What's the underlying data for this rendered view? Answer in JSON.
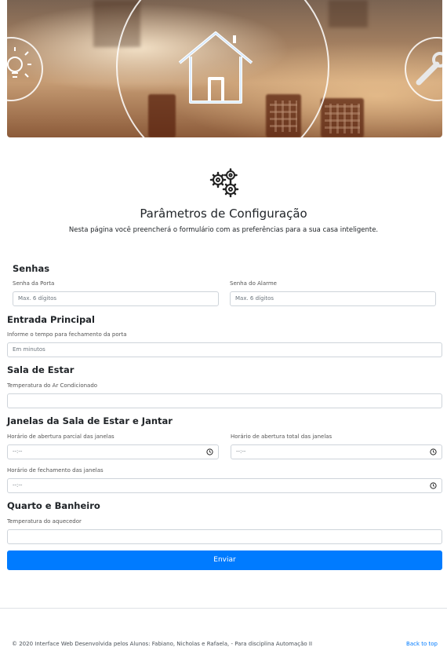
{
  "header": {
    "title": "Parâmetros de Configuração",
    "subtitle": "Nesta página você preencherá o formulário com as preferências para a sua casa inteligente."
  },
  "sections": {
    "senhas": {
      "title": "Senhas",
      "porta_label": "Senha da Porta",
      "porta_placeholder": "Max. 6 dígitos",
      "alarme_label": "Senha do Alarme",
      "alarme_placeholder": "Max. 6 dígitos"
    },
    "entrada": {
      "title": "Entrada Principal",
      "tempo_label": "Informe o tempo para fechamento da porta",
      "tempo_placeholder": "Em minutos"
    },
    "sala": {
      "title": "Sala de Estar",
      "temp_label": "Temperatura do Ar Condicionado",
      "temp_value": ""
    },
    "janelas": {
      "title": "Janelas da Sala de Estar e Jantar",
      "parcial_label": "Horário de abertura parcial das janelas",
      "parcial_value": "--:--",
      "total_label": "Horário de abertura total das janelas",
      "total_value": "--:--",
      "fechamento_label": "Horário de fechamento das janelas",
      "fechamento_value": "--:--"
    },
    "quarto": {
      "title": "Quarto e Banheiro",
      "temp_label": "Temperatura do aquecedor",
      "temp_value": ""
    }
  },
  "submit_label": "Enviar",
  "footer": {
    "text": "© 2020 Interface Web Desenvolvida pelos Alunos: Fabiano, Nicholas e Rafaela, - Para disciplina Automação II",
    "back_to_top": "Back to top"
  },
  "icons": {
    "hero_left": "lightbulb-icon",
    "hero_center": "house-icon",
    "hero_right": "wrench-icon",
    "header": "gears-icon",
    "time_inputs": "clock-icon"
  },
  "colors": {
    "primary": "#007bff",
    "border": "#ced4da",
    "text": "#212529"
  }
}
